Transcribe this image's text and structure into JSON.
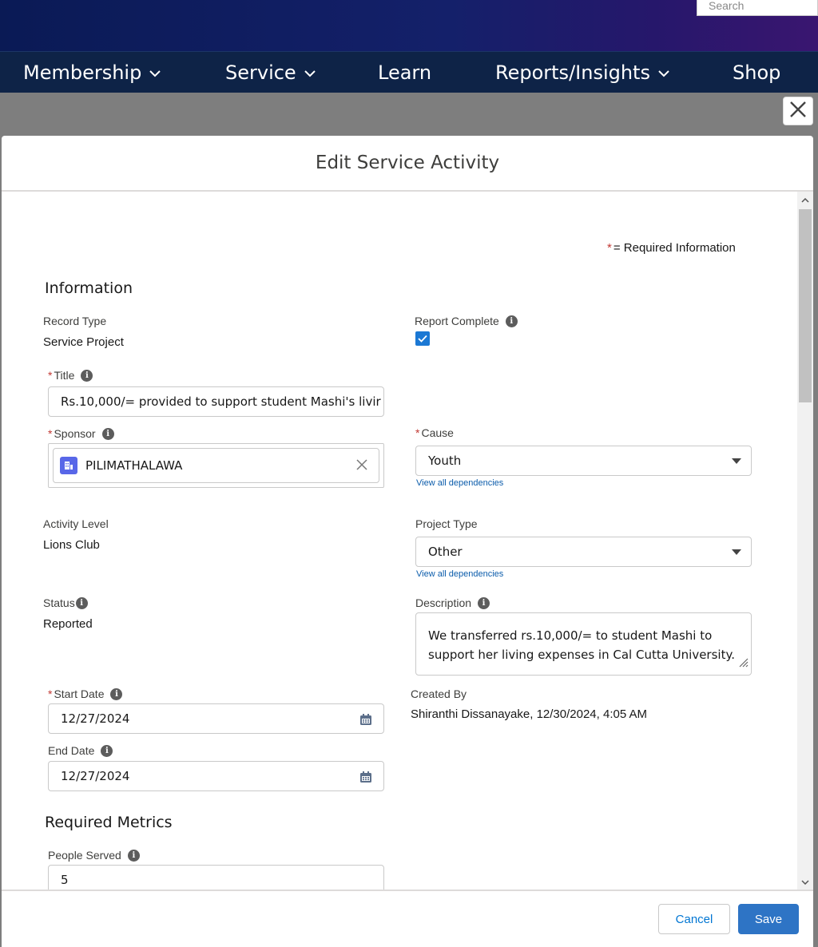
{
  "header": {
    "search_placeholder": "Search",
    "nav": [
      {
        "label": "Membership"
      },
      {
        "label": "Service"
      },
      {
        "label": "Learn"
      },
      {
        "label": "Reports/Insights"
      },
      {
        "label": "Shop"
      }
    ]
  },
  "modal": {
    "title": "Edit Service Activity",
    "required_note": "= Required Information",
    "required_mark": "*",
    "sections": {
      "information": "Information",
      "required_metrics": "Required Metrics"
    },
    "fields": {
      "record_type": {
        "label": "Record Type",
        "value": "Service Project"
      },
      "report_complete": {
        "label": "Report Complete",
        "checked": true
      },
      "title": {
        "label": "Title",
        "value": "Rs.10,000/= provided to support student Mashi's livir"
      },
      "sponsor": {
        "label": "Sponsor",
        "value": "PILIMATHALAWA"
      },
      "cause": {
        "label": "Cause",
        "value": "Youth",
        "link": "View all dependencies"
      },
      "activity_level": {
        "label": "Activity Level",
        "value": "Lions Club"
      },
      "project_type": {
        "label": "Project Type",
        "value": "Other",
        "link": "View all dependencies"
      },
      "status": {
        "label": "Status",
        "value": "Reported"
      },
      "description": {
        "label": "Description",
        "value": "We transferred rs.10,000/= to student Mashi to support her living expenses in Cal Cutta University."
      },
      "start_date": {
        "label": "Start Date",
        "value": "12/27/2024"
      },
      "end_date": {
        "label": "End Date",
        "value": "12/27/2024"
      },
      "created_by": {
        "label": "Created By",
        "value": "Shiranthi Dissanayake, 12/30/2024, 4:05 AM"
      },
      "people_served": {
        "label": "People Served",
        "value": "5"
      }
    },
    "buttons": {
      "cancel": "Cancel",
      "save": "Save"
    }
  },
  "icons": {
    "info": "info-icon",
    "calendar": "calendar-icon",
    "close": "close-icon",
    "account": "account-icon",
    "clear": "clear-icon"
  },
  "colors": {
    "primary": "#2e74c5",
    "required": "#c23934",
    "link": "#0b5cab",
    "nav_bg": "#0e2347"
  }
}
